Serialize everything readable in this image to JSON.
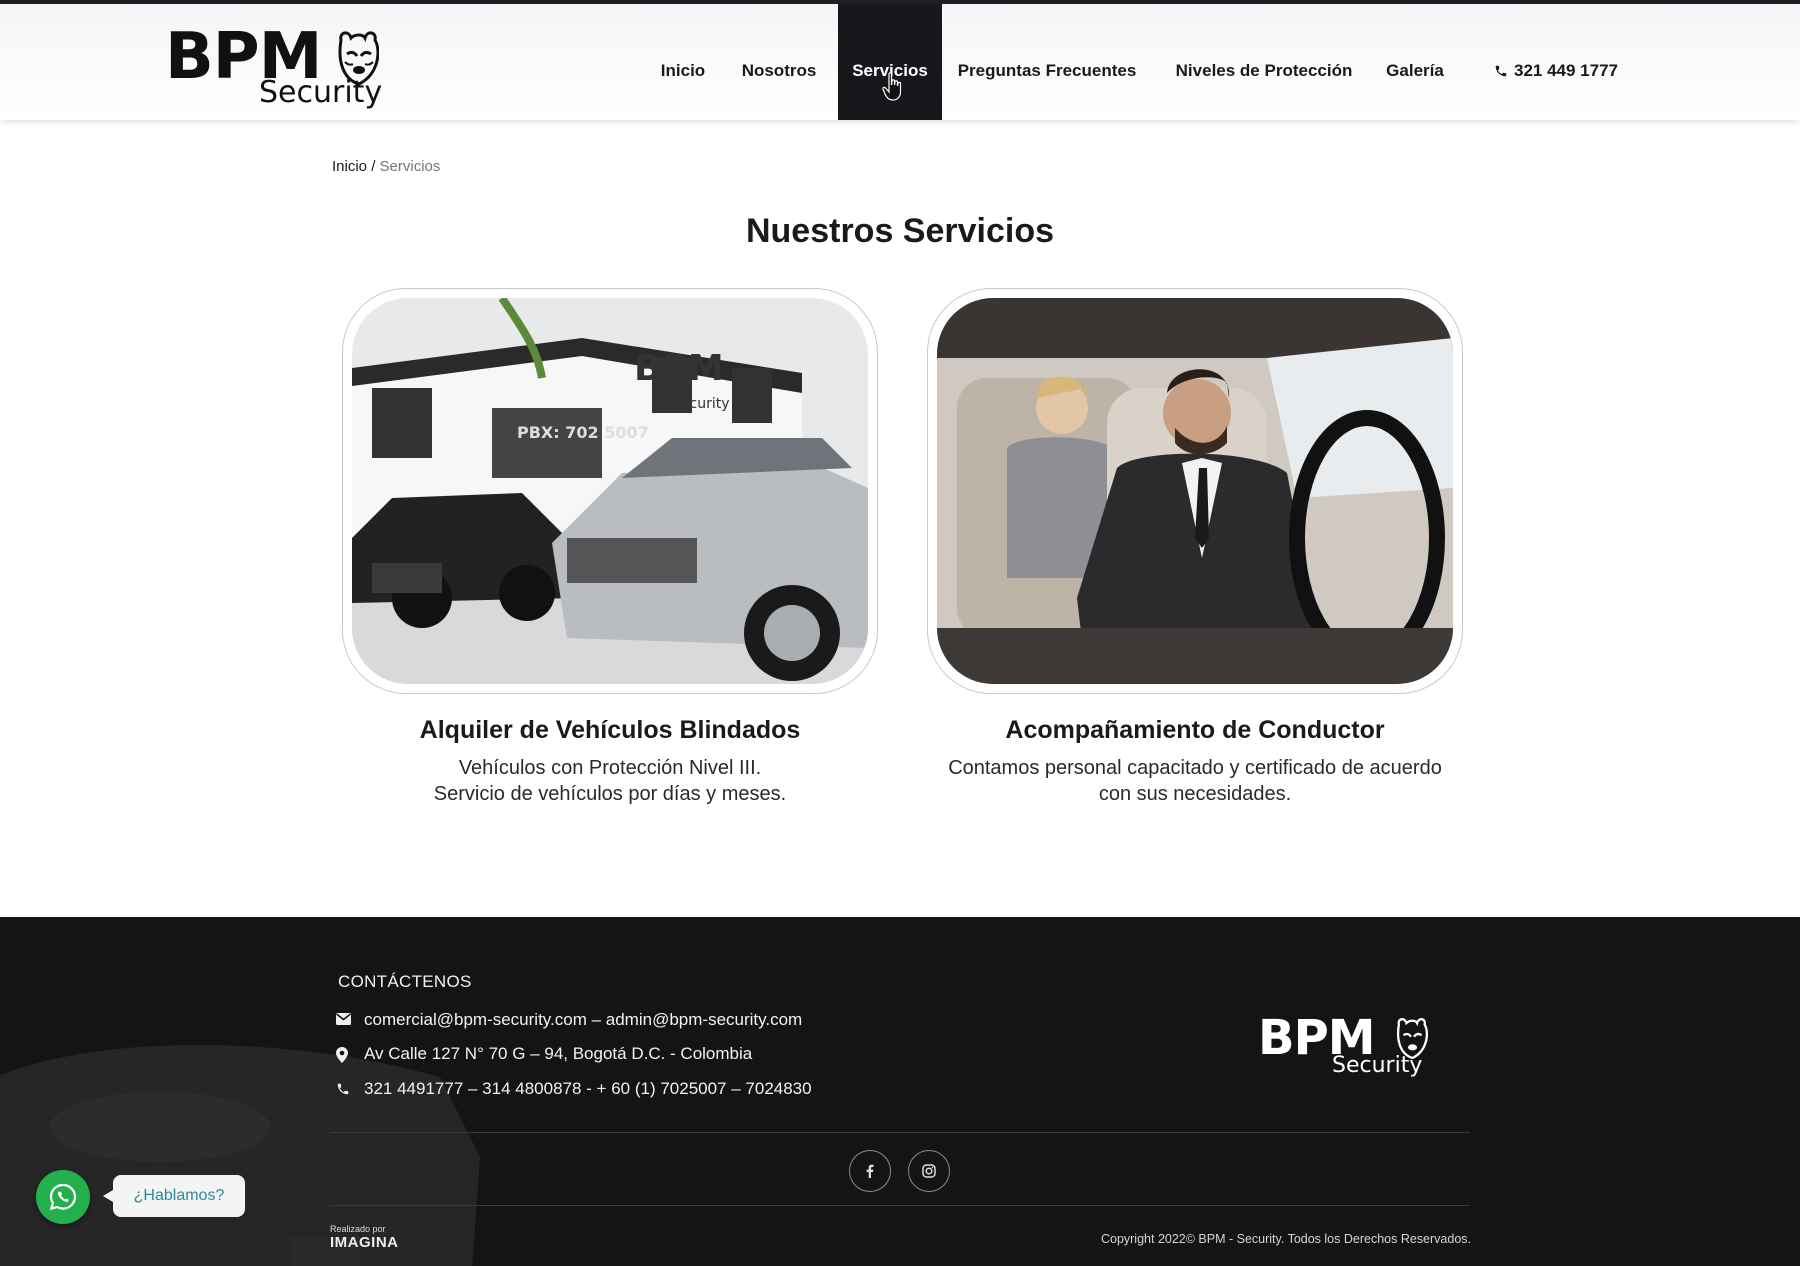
{
  "brand": {
    "logo_main": "BPM",
    "logo_sub": "Security"
  },
  "nav": {
    "items": [
      {
        "label": "Inicio"
      },
      {
        "label": "Nosotros"
      },
      {
        "label": "Servicios",
        "active": true
      },
      {
        "label": "Preguntas Frecuentes"
      },
      {
        "label": "Niveles de Protección"
      },
      {
        "label": "Galería"
      }
    ],
    "phone": "321 449 1777"
  },
  "breadcrumb": {
    "home": "Inicio",
    "separator": "/",
    "current": "Servicios"
  },
  "main": {
    "title": "Nuestros Servicios",
    "services": [
      {
        "title": "Alquiler de Vehículos Blindados",
        "lines": [
          "Vehículos con Protección Nivel III.",
          "Servicio de vehículos por días y meses."
        ],
        "photo_text": [
          "BPM",
          "Security",
          "PBX: 702 5007"
        ]
      },
      {
        "title": "Acompañamiento de Conductor",
        "lines": [
          "Contamos personal capacitado y certificado de acuerdo",
          "con sus necesidades."
        ]
      }
    ]
  },
  "footer": {
    "contact_title": "CONTÁCTENOS",
    "email": "comercial@bpm-security.com – admin@bpm-security.com",
    "address": "Av Calle 127 N° 70 G – 94, Bogotá D.C. - Colombia",
    "phones": "321 4491777 – 314 4800878 - + 60 (1) 7025007 – 7024830",
    "made_by_label": "Realizado por",
    "made_by_brand": "IMAGINA",
    "copyright": "Copyright 2022© BPM - Security. Todos los Derechos Reservados."
  },
  "whatsapp": {
    "bubble": "¿Hablamos?"
  },
  "colors": {
    "nav_active_bg": "#16181c",
    "footer_bg": "#141414",
    "whatsapp": "#25b04e",
    "bubble_text": "#2b8a9a"
  }
}
